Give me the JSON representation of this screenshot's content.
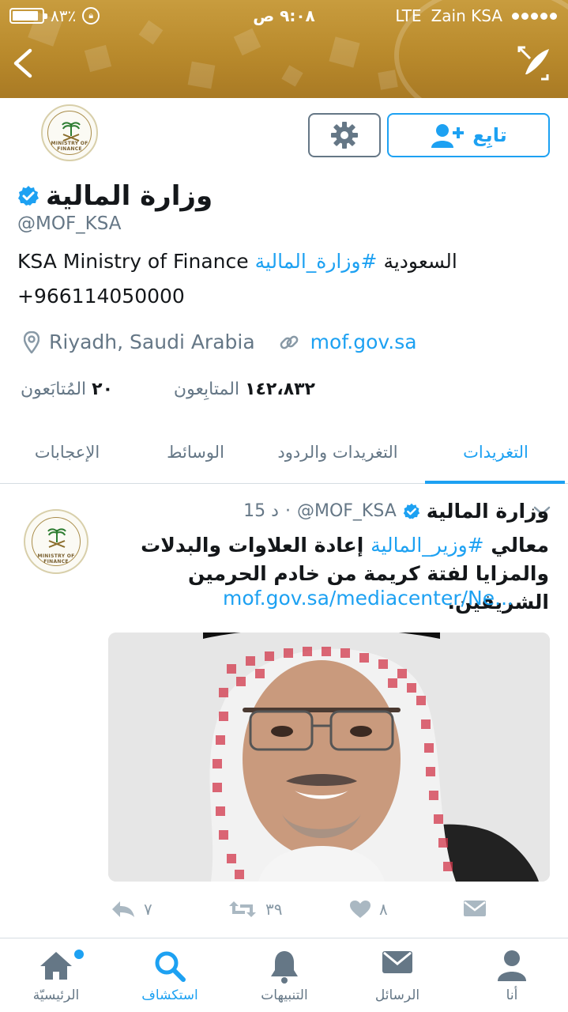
{
  "status_bar": {
    "battery": "٨٣٪",
    "time": "٩:٠٨ ص",
    "network": "LTE",
    "carrier": "Zain KSA"
  },
  "profile": {
    "display_name": "وزارة المالية",
    "handle": "@MOF_KSA",
    "bio_hashtag": "#وزارة_المالية",
    "bio_rest": "KSA Ministry of Finance السعودية",
    "phone": "+966114050000",
    "location": "Riyadh, Saudi Arabia",
    "website": "mof.gov.sa",
    "followers_count": "١٤٢،٨٣٢",
    "followers_label": "المتابِعون",
    "following_count": "٢٠",
    "following_label": "المُتابَعون",
    "follow_label": "تابِع",
    "logo_text": "MINISTRY OF FINANCE"
  },
  "tabs": {
    "tweets": "التغريدات",
    "tweets_replies": "التغريدات والردود",
    "media": "الوسائط",
    "likes": "الإعجابات"
  },
  "tweet": {
    "author_name": "وزارة المالية",
    "author_handle": "@MOF_KSA",
    "time": "15 د",
    "text_start": "معالي",
    "hashtag": "#وزير_المالية",
    "text_rest": "إعادة العلاوات والبدلات والمزايا لفتة كريمة من خادم الحرمين الشريفين.",
    "link": "mof.gov.sa/mediacenter/Ne...",
    "reply_count": "٧",
    "retweet_count": "٣٩",
    "like_count": "٨"
  },
  "bottom_nav": {
    "home": "الرئيسيّة",
    "explore": "استكشاف",
    "notifications": "التنبيهات",
    "messages": "الرسائل",
    "me": "أنا"
  },
  "colors": {
    "accent": "#1da1f2",
    "banner": "#b98a2c",
    "muted": "#657786"
  }
}
